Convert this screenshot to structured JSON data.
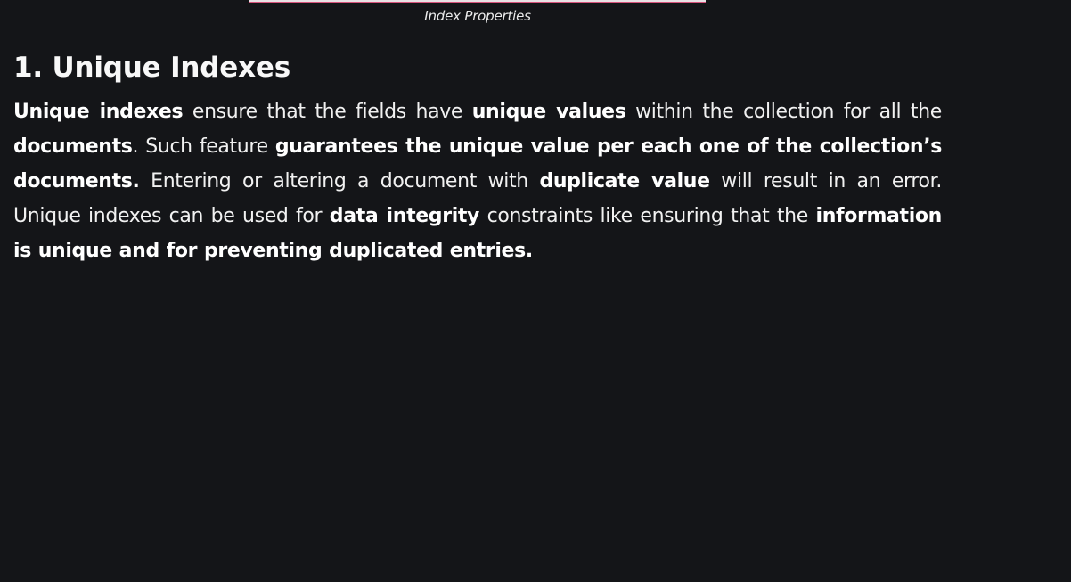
{
  "figure": {
    "caption": "Index Properties"
  },
  "section": {
    "title": "1. Unique Indexes",
    "paragraph": [
      {
        "text": "Unique indexes",
        "bold": true
      },
      {
        "text": " ensure that the fields have ",
        "bold": false
      },
      {
        "text": "unique values",
        "bold": true
      },
      {
        "text": " within the collection for all the ",
        "bold": false
      },
      {
        "text": "documents",
        "bold": true
      },
      {
        "text": ". Such feature ",
        "bold": false
      },
      {
        "text": "guarantees the unique value per each one of the collection’s documents.",
        "bold": true
      },
      {
        "text": " Entering or altering a document with ",
        "bold": false
      },
      {
        "text": "duplicate value",
        "bold": true
      },
      {
        "text": " will result in an error. Unique indexes can be used for ",
        "bold": false
      },
      {
        "text": "data integrity",
        "bold": true
      },
      {
        "text": " constraints like ensuring that the ",
        "bold": false
      },
      {
        "text": "information is unique and for preventing duplicated entries.",
        "bold": true
      }
    ]
  }
}
